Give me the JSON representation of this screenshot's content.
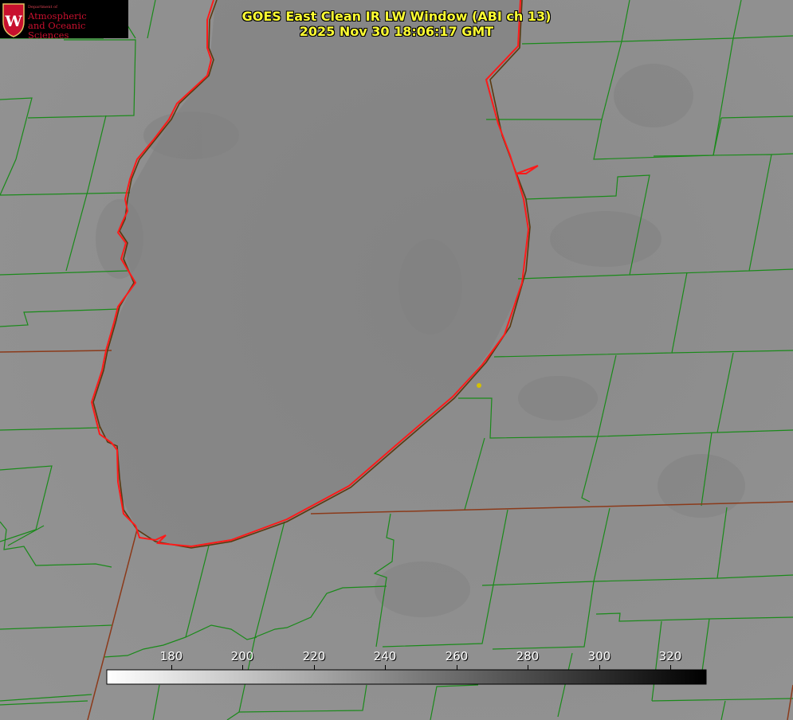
{
  "logo": {
    "letter": "W",
    "department": "Department of",
    "line1": "Atmospheric",
    "line2": "and Oceanic Sciences"
  },
  "title": {
    "line1": "GOES East Clean IR LW Window (ABI ch 13)",
    "line2": "2025 Nov 30 18:06:17 GMT"
  },
  "colorbar": {
    "ticks": [
      "180",
      "200",
      "220",
      "240",
      "260",
      "280",
      "300",
      "320"
    ],
    "gradient_start": "#ffffff",
    "gradient_end": "#000000"
  },
  "colors": {
    "county_lines": "#1a8a1a",
    "state_lines": "#8b3a1a",
    "shoreline": "#ff2020",
    "marker": "#d4c000",
    "background": "#8e8e8e",
    "lake": "#7f7f7f"
  }
}
